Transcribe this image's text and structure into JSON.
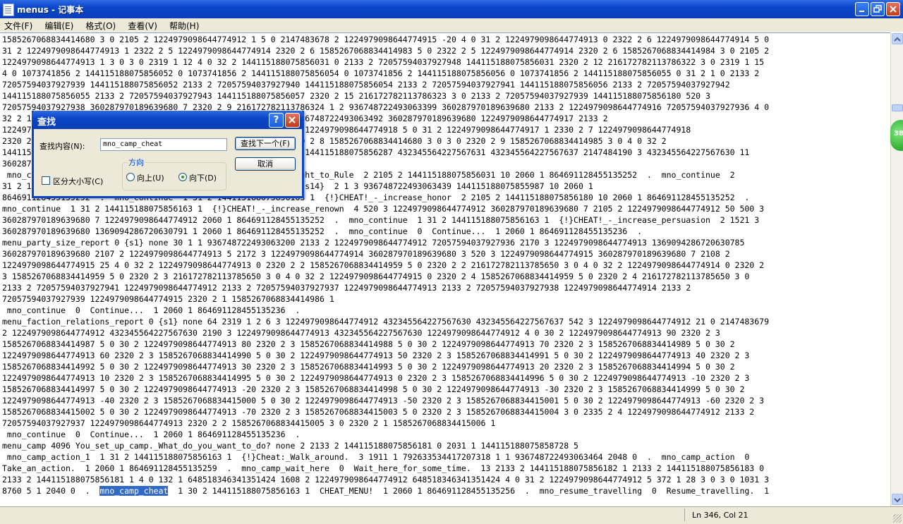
{
  "window": {
    "title": "menus - 记事本"
  },
  "menubar": [
    "文件(F)",
    "编辑(E)",
    "格式(O)",
    "查看(V)",
    "帮助(H)"
  ],
  "editor": {
    "lines": [
      "1585267068834414680 3 0 2105 2 1224979098644774912 1 5 0 2147483678 2 1224979098644774915 -20 4 0 31 2 1224979098644774913 0 2322 2 6 1224979098644774914 5 0",
      "31 2 1224979098644774913 1 2322 2 5 1224979098644774914 2320 2 6 1585267068834414983 5 0 2322 2 5 1224979098644774914 2320 2 6 1585267068834414984 3 0 2105 2",
      "1224979098644774913 1 3 0 3 0 2319 1 12 4 0 32 2 144115188075856031 0 2133 2 72057594037927948 144115188075856031 2320 2 12 216172782113786322 3 0 2319 1 15",
      "4 0 1073741856 2 144115188075856052 0 1073741856 2 144115188075856054 0 1073741856 2 144115188075856056 0 1073741856 2 144115188075856055 0 31 2 1 0 2133 2",
      "72057594037927939 144115188075856052 2133 2 72057594037927940 144115188075856054 2133 2 72057594037927941 144115188075856056 2133 2 72057594037927942",
      "144115188075856055 2133 2 72057594037927943 144115188075856057 2320 2 15 216172782113786323 3 0 2133 2 72057594037927939 144115188075856180 520 3",
      "72057594037927938 360287970189639680 7 2320 2 9 216172782113786324 1 2 936748722493063399 360287970189639680 2133 2 1224979098644774916 72057594037927936 4 0",
      "32 2 1224979098644774912 0 2320 2 7 1224979098644774916 1 3 936748722493063492 360287970189639680 1224979098644774917 2133 2",
      "1224979098644774917 0 2330 2 8 1224979098644774917 0 2330 2 8 1224979098644774918 5 0 31 2 1224979098644774917 1 2330 2 7 1224979098644774918",
      "2320 2 6 1585267068834414680 2320 2 8 1585267068834414680 2320 2 8 1585267068834414680 3 0 3 0 2320 2 9 1585267068834414985 3 0 4 0 32 2",
      "144115188075857 0 1073741856 2 144115188075857 3 1073741857 3 144115188075856287 432345564227567631 432345564227567637 2147484190 3 432345564227567630 11",
      "360287970189639680 1 2320 2 9 216172782113786996 3 0 3 0 6",
      " mno_continue  1 31 2 144115188075856 {!}CHEAT!_-_increase_Right_to_Rule  2 2105 2 144115188075856031 10 2060 1 864691128455135252  .  mno_continue  2",
      "31 2 144115188075856 {!}CHEAT!_-_increase_your_relation_with_{s14}  2 1 3 936748722493063439 144115188075855987 10 2060 1",
      "864691128455135252  .  mno_continue  1 31 2 144115188075856163 1  {!}CHEAT!_-_increase_honor  2 2105 2 144115188075856180 10 2060 1 864691128455135252  .",
      "mno_continue  1 31 2 144115188075856163 1  {!}CHEAT!_-_increase_renown  4 520 3 1224979098644774912 360287970189639680 7 2105 2 1224979098644774912 50 500 3",
      "360287970189639680 7 1224979098644774912 2060 1 864691128455135252  .  mno_continue  1 31 2 144115188075856163 1  {!}CHEAT!_-_increase_persuasion  2 1521 3",
      "360287970189639680 1369094286720630791 1 2060 1 864691128455135252  .  mno_continue  0  Continue...  1 2060 1 864691128455135236  .",
      "menu_party_size_report 0 {s1} none 30 1 1 936748722493063200 2133 2 1224979098644774912 72057594037927936 2170 3 1224979098644774913 1369094286720630785",
      "360287970189639680 2107 2 1224979098644774913 5 2172 3 1224979098644774914 360287970189639680 3 520 3 1224979098644774915 360287970189639680 7 2108 2",
      "1224979098644774915 25 4 0 32 2 1224979098644774913 0 2320 2 2 1585267068834414959 5 0 2320 2 2 216172782113785650 3 0 4 0 32 2 1224979098644774914 0 2320 2",
      "3 1585267068834414959 5 0 2320 2 3 216172782113785650 3 0 4 0 32 2 1224979098644774915 0 2320 2 4 1585267068834414959 5 0 2320 2 4 216172782113785650 3 0",
      "2133 2 72057594037927941 1224979098644774912 2133 2 72057594037927937 1224979098644774913 2133 2 72057594037927938 1224979098644774914 2133 2",
      "72057594037927939 1224979098644774915 2320 2 1 1585267068834414986 1",
      " mno_continue  0  Continue...  1 2060 1 864691128455135236  .",
      "menu_faction_relations_report 0 {s1} none 64 2319 1 2 6 3 1224979098644774912 432345564227567630 432345564227567637 542 3 1224979098644774912 21 0 2147483679",
      "2 1224979098644774912 432345564227567630 2190 3 1224979098644774913 432345564227567630 1224979098644774912 4 0 30 2 1224979098644774913 90 2320 2 3",
      "1585267068834414987 5 0 30 2 1224979098644774913 80 2320 2 3 1585267068834414988 5 0 30 2 1224979098644774913 70 2320 2 3 1585267068834414989 5 0 30 2",
      "1224979098644774913 60 2320 2 3 1585267068834414990 5 0 30 2 1224979098644774913 50 2320 2 3 1585267068834414991 5 0 30 2 1224979098644774913 40 2320 2 3",
      "1585267068834414992 5 0 30 2 1224979098644774913 30 2320 2 3 1585267068834414993 5 0 30 2 1224979098644774913 20 2320 2 3 1585267068834414994 5 0 30 2",
      "1224979098644774913 10 2320 2 3 1585267068834414995 5 0 30 2 1224979098644774913 0 2320 2 3 1585267068834414996 5 0 30 2 1224979098644774913 -10 2320 2 3",
      "1585267068834414997 5 0 30 2 1224979098644774913 -20 2320 2 3 1585267068834414998 5 0 30 2 1224979098644774913 -30 2320 2 3 1585267068834414999 5 0 30 2",
      "1224979098644774913 -40 2320 2 3 1585267068834415000 5 0 30 2 1224979098644774913 -50 2320 2 3 1585267068834415001 5 0 30 2 1224979098644774913 -60 2320 2 3",
      "1585267068834415002 5 0 30 2 1224979098644774913 -70 2320 2 3 1585267068834415003 5 0 2320 2 3 1585267068834415004 3 0 2335 2 4 1224979098644774912 2133 2",
      "72057594037927937 1224979098644774913 2320 2 2 1585267068834415005 3 0 2320 2 1 1585267068834415006 1",
      " mno_continue  0  Continue...  1 2060 1 864691128455135236  .",
      "menu_camp 4096 You_set_up_camp._What_do_you_want_to_do? none 2 2133 2 144115188075856181 0 2031 1 144115188075858728 5",
      " mno_camp_action_1  1 31 2 144115188075856163 1  {!}Cheat:_Walk_around.  3 1911 1 792633534417207318 1 1 936748722493063464 2048 0  .  mno_camp_action  0",
      "Take_an_action.  1 2060 1 864691128455135259  .  mno_camp_wait_here  0  Wait_here_for_some_time.  13 2133 2 144115188075856182 1 2133 2 144115188075856183 0",
      "2133 2 144115188075856181 1 4 0 132 1 648518346341351424 1608 2 1224979098644774912 648518346341351424 4 0 31 2 1224979098644774912 5 372 1 28 3 0 3 0 1031 3"
    ],
    "last_before": "8760 5 1 2040 0  .  ",
    "last_selected": "mno_camp_cheat",
    "last_after": "  1 30 2 144115188075856163 1  CHEAT_MENU!  1 2060 1 864691128455135256  .  mno_resume_travelling  0  Resume_travelling.  1"
  },
  "status": {
    "position": "Ln 346, Col 21"
  },
  "badge": {
    "label": "38"
  },
  "find_dialog": {
    "title": "查找",
    "find_label": "查找内容(N):",
    "find_value": "mno_camp_cheat",
    "find_next": "查找下一个(F)",
    "cancel": "取消",
    "direction_label": "方向",
    "up_label": "向上(U)",
    "down_label": "向下(D)",
    "match_case": "区分大小写(C)",
    "direction_selected": "down"
  }
}
